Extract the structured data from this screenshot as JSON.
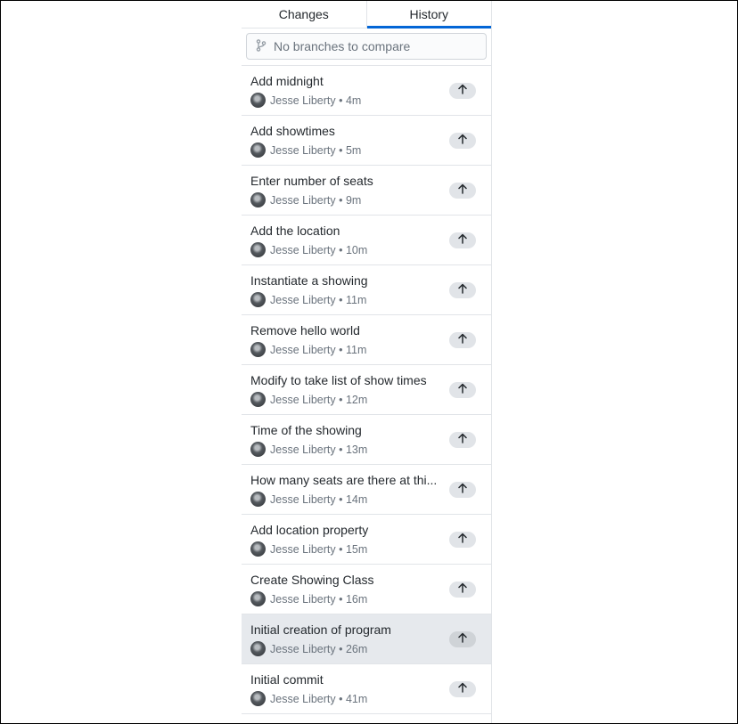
{
  "tabs": {
    "changes": "Changes",
    "history": "History"
  },
  "compare": {
    "placeholder": "No branches to compare"
  },
  "commits": [
    {
      "summary": "Add midnight",
      "author": "Jesse Liberty",
      "time": "4m"
    },
    {
      "summary": "Add showtimes",
      "author": "Jesse Liberty",
      "time": "5m"
    },
    {
      "summary": "Enter number of seats",
      "author": "Jesse Liberty",
      "time": "9m"
    },
    {
      "summary": "Add the location",
      "author": "Jesse Liberty",
      "time": "10m"
    },
    {
      "summary": "Instantiate a showing",
      "author": "Jesse Liberty",
      "time": "11m"
    },
    {
      "summary": "Remove hello world",
      "author": "Jesse Liberty",
      "time": "11m"
    },
    {
      "summary": "Modify to take list of show times",
      "author": "Jesse Liberty",
      "time": "12m"
    },
    {
      "summary": "Time of the showing",
      "author": "Jesse Liberty",
      "time": "13m"
    },
    {
      "summary": "How many seats are there at thi...",
      "author": "Jesse Liberty",
      "time": "14m"
    },
    {
      "summary": "Add location property",
      "author": "Jesse Liberty",
      "time": "15m"
    },
    {
      "summary": "Create Showing Class",
      "author": "Jesse Liberty",
      "time": "16m"
    },
    {
      "summary": "Initial creation of program",
      "author": "Jesse Liberty",
      "time": "26m",
      "selected": true
    },
    {
      "summary": "Initial commit",
      "author": "Jesse Liberty",
      "time": "41m"
    }
  ],
  "colors": {
    "accent": "#0366d6",
    "selected_row": "#e6e9ed"
  },
  "icons": {
    "compare": "git-branch-icon",
    "push": "arrow-up-icon"
  }
}
